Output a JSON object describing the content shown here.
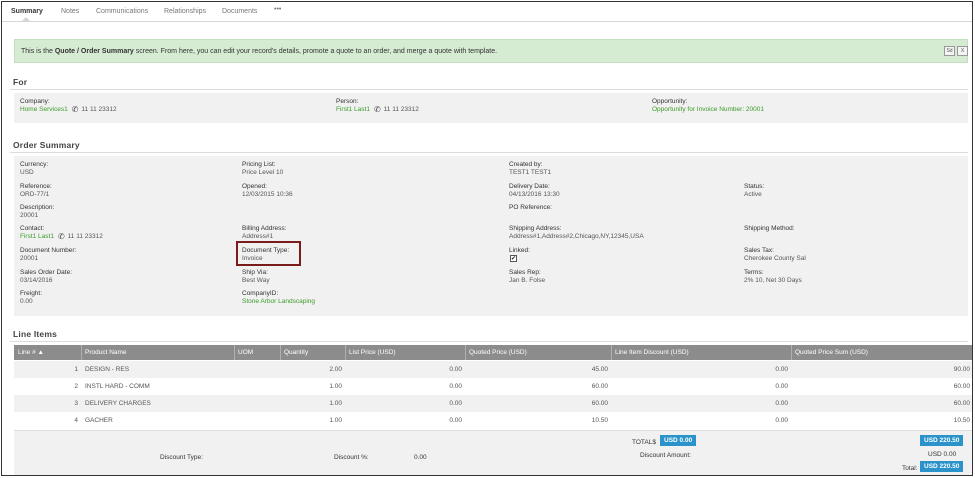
{
  "tabs": [
    "Summary",
    "Notes",
    "Communications",
    "Relationships",
    "Documents",
    "•••"
  ],
  "notice": {
    "prefix": "This is the ",
    "bold": "Quote / Order Summary",
    "suffix": " screen. From here, you can edit your record's details, promote a quote to an order, and merge a quote with template.",
    "btn1": "Sd",
    "btn2": "X"
  },
  "for_section": {
    "title": "For",
    "company_label": "Company:",
    "company_value": "Home Services1",
    "company_phone": "11 11 23312",
    "person_label": "Person:",
    "person_value": "First1 Last1",
    "person_phone": "11 11 23312",
    "opportunity_label": "Opportunity:",
    "opportunity_value": "Opportunity for Invoice Number: 20001"
  },
  "order_summary": {
    "title": "Order Summary",
    "currency_label": "Currency:",
    "currency_value": "USD",
    "pricing_list_label": "Pricing List:",
    "pricing_list_value": "Price Level 10",
    "created_by_label": "Created by:",
    "created_by_value": "TEST1 TEST1",
    "reference_label": "Reference:",
    "reference_value": "ORD-77/1",
    "opened_label": "Opened:",
    "opened_value": "12/03/2015 10:36",
    "delivery_date_label": "Delivery Date:",
    "delivery_date_value": "04/13/2016 13:30",
    "status_label": "Status:",
    "status_value": "Active",
    "description_label": "Description:",
    "description_value": "20001",
    "po_reference_label": "PO Reference:",
    "contact_label": "Contact:",
    "contact_value": "First1 Last1",
    "contact_phone": "11 11 23312",
    "billing_address_label": "Billing Address:",
    "billing_address_value": "Address#1",
    "shipping_address_label": "Shipping Address:",
    "shipping_address_value": "Address#1,Address#2,Chicago,NY,12345,USA",
    "shipping_method_label": "Shipping Method:",
    "document_number_label": "Document Number:",
    "document_number_value": "20001",
    "document_type_label": "Document Type:",
    "document_type_value": "Invoice",
    "linked_label": "Linked:",
    "linked_checked": "✔",
    "sales_tax_label": "Sales Tax:",
    "sales_tax_value": "Cherokee County Sal",
    "sales_order_date_label": "Sales Order Date:",
    "sales_order_date_value": "03/14/2016",
    "ship_via_label": "Ship Via:",
    "ship_via_value": "Best Way",
    "sales_rep_label": "Sales Rep:",
    "sales_rep_value": "Jan B. Folse",
    "terms_label": "Terms:",
    "terms_value": "2% 10, Net 30 Days",
    "freight_label": "Freight:",
    "freight_value": "0.00",
    "company_id_label": "CompanyID:",
    "company_id_value": "Stone Arbor Landscaping"
  },
  "line_items": {
    "title": "Line Items",
    "columns": [
      "Line # ▲",
      "Product Name",
      "UOM",
      "Quantity",
      "List Price (USD)",
      "Quoted Price (USD)",
      "Line Item Discount (USD)",
      "Quoted Price Sum (USD)"
    ],
    "rows": [
      {
        "line": "1",
        "product": "DESIGN - RES",
        "uom": "",
        "qty": "2.00",
        "list": "0.00",
        "quoted": "45.00",
        "discount": "0.00",
        "sum": "90.00"
      },
      {
        "line": "2",
        "product": "INSTL HARD - COMM",
        "uom": "",
        "qty": "1.00",
        "list": "0.00",
        "quoted": "60.00",
        "discount": "0.00",
        "sum": "60.00"
      },
      {
        "line": "3",
        "product": "DELIVERY CHARGES",
        "uom": "",
        "qty": "1.00",
        "list": "0.00",
        "quoted": "60.00",
        "discount": "0.00",
        "sum": "60.00"
      },
      {
        "line": "4",
        "product": "GACHER",
        "uom": "",
        "qty": "1.00",
        "list": "0.00",
        "quoted": "10.50",
        "discount": "0.00",
        "sum": "10.50"
      }
    ]
  },
  "totals": {
    "totals_label": "TOTAL$",
    "discount_total_badge": "USD 0.00",
    "sum_total_badge": "USD 220.50",
    "discount_type_label": "Discount Type:",
    "discount_pct_label": "Discount %:",
    "discount_pct_value": "0.00",
    "discount_amount_label": "Discount Amount:",
    "discount_amount_value": "USD 0.00",
    "total_label": "Total:",
    "total_badge": "USD 220.50"
  },
  "colors": {
    "link_green": "#3b9b2a",
    "notice_bg": "#d5ecd2",
    "header_gray": "#8c8c8c",
    "badge_blue": "#2a93c9",
    "highlight_border": "#7a1c1c"
  }
}
